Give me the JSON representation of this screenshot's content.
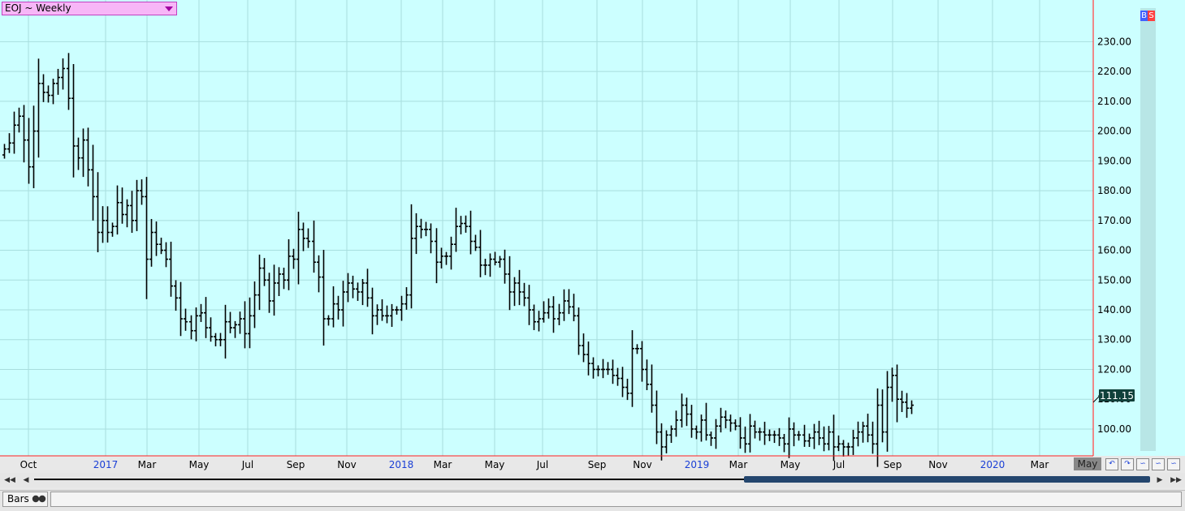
{
  "symbol": {
    "label": "EOJ ~ Weekly"
  },
  "toggles": {
    "buy": "B",
    "sell": "S"
  },
  "colors": {
    "plot_bg": "#ccffff",
    "grid": "#a8dede",
    "bar": "#000000",
    "axis_line": "#ff2020",
    "price_tag": "#10403a"
  },
  "price_tag": {
    "value": "111.15"
  },
  "x_axis": {
    "ticks": [
      {
        "label": "Oct",
        "year": false
      },
      {
        "label": "2017",
        "year": true
      },
      {
        "label": "Mar",
        "year": false
      },
      {
        "label": "May",
        "year": false
      },
      {
        "label": "Jul",
        "year": false
      },
      {
        "label": "Sep",
        "year": false
      },
      {
        "label": "Nov",
        "year": false
      },
      {
        "label": "2018",
        "year": true
      },
      {
        "label": "Mar",
        "year": false
      },
      {
        "label": "May",
        "year": false
      },
      {
        "label": "Jul",
        "year": false
      },
      {
        "label": "Sep",
        "year": false
      },
      {
        "label": "Nov",
        "year": false
      },
      {
        "label": "2019",
        "year": true
      },
      {
        "label": "Mar",
        "year": false
      },
      {
        "label": "May",
        "year": false
      },
      {
        "label": "Jul",
        "year": false
      },
      {
        "label": "Sep",
        "year": false
      },
      {
        "label": "Nov",
        "year": false
      },
      {
        "label": "2020",
        "year": true
      },
      {
        "label": "Mar",
        "year": false
      }
    ],
    "current": "May"
  },
  "bottom": {
    "chart_type": "Bars"
  },
  "chart_data": {
    "type": "bar",
    "subtype": "ohlc",
    "title": "EOJ ~ Weekly",
    "ylim": [
      91,
      244
    ],
    "y_ticks": [
      100,
      110,
      120,
      130,
      140,
      150,
      160,
      170,
      180,
      190,
      200,
      210,
      220,
      230
    ],
    "y_tick_labels": [
      "100.00",
      "110.00",
      "120.00",
      "130.00",
      "140.00",
      "150.00",
      "160.00",
      "170.00",
      "180.00",
      "190.00",
      "200.00",
      "210.00",
      "220.00",
      "230.00"
    ],
    "last_price": 111.15,
    "grid": true,
    "closes": [
      194,
      196,
      202,
      205,
      197,
      188,
      200,
      216,
      213,
      212,
      216,
      218,
      221,
      211,
      195,
      191,
      197,
      187,
      178,
      166,
      170,
      166,
      168,
      176,
      172,
      175,
      170,
      180,
      178,
      157,
      166,
      162,
      160,
      157,
      148,
      144,
      137,
      136,
      133,
      138,
      139,
      134,
      131,
      130,
      130,
      136,
      134,
      135,
      137,
      132,
      138,
      145,
      154,
      150,
      143,
      149,
      152,
      150,
      158,
      157,
      167,
      164,
      163,
      156,
      151,
      137,
      137,
      142,
      140,
      146,
      149,
      147,
      146,
      149,
      144,
      138,
      140,
      138,
      138,
      140,
      140,
      142,
      145,
      164,
      168,
      167,
      167,
      163,
      156,
      158,
      158,
      162,
      168,
      169,
      168,
      163,
      161,
      155,
      155,
      157,
      156,
      157,
      152,
      146,
      149,
      146,
      144,
      140,
      136,
      137,
      139,
      141,
      137,
      139,
      143,
      141,
      138,
      128,
      125,
      122,
      120,
      120,
      120,
      120,
      118,
      117,
      114,
      112,
      127,
      127,
      120,
      115,
      108,
      99,
      94,
      98,
      100,
      103,
      108,
      105,
      100,
      99,
      103,
      98,
      97,
      101,
      104,
      103,
      102,
      101,
      97,
      95,
      101,
      99,
      99,
      98,
      98,
      98,
      97,
      95,
      100,
      98,
      98,
      96,
      97,
      99,
      97,
      95,
      99,
      94,
      95,
      94,
      94,
      97,
      99,
      101,
      98,
      95,
      108,
      99,
      114,
      118,
      110,
      109,
      107,
      108
    ]
  }
}
